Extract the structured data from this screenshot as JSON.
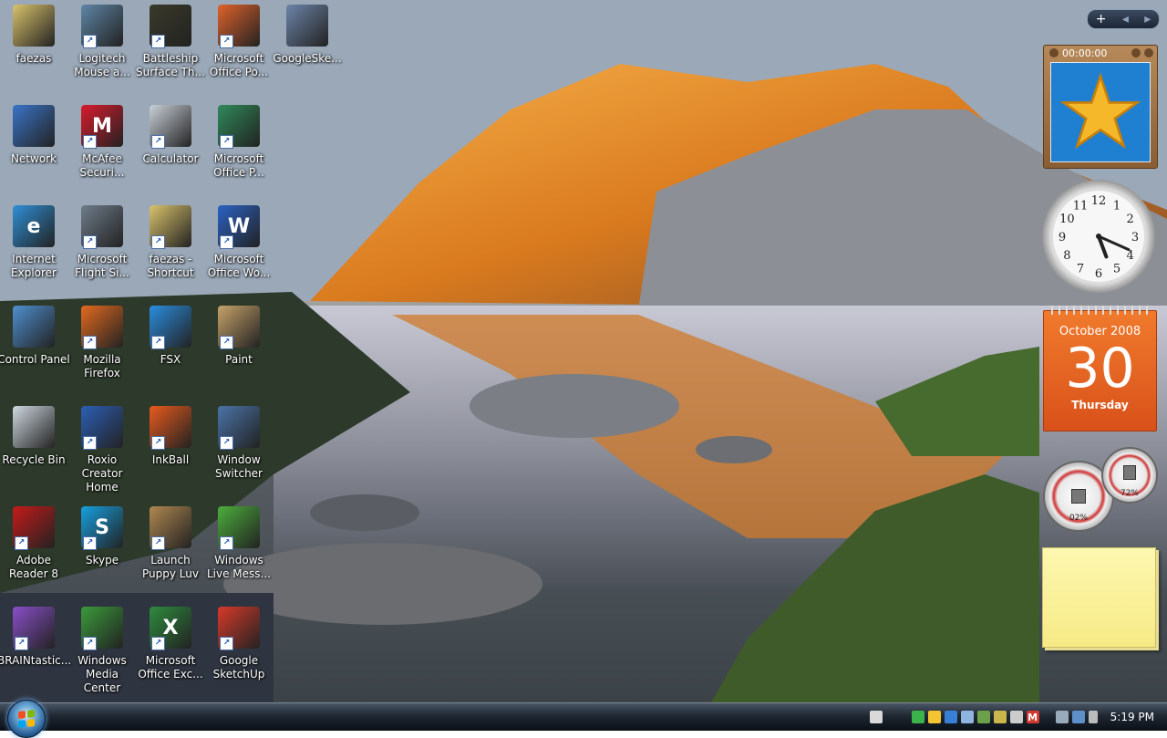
{
  "desktop": {
    "icons": [
      {
        "label": "faezas",
        "icon": "folder-icon",
        "color": "#d9c36b",
        "glyph": "",
        "shortcut": false
      },
      {
        "label": "Logitech Mouse a...",
        "icon": "mouse-icon",
        "color": "#5f86a6",
        "glyph": "",
        "shortcut": true
      },
      {
        "label": "Battleship Surface Th...",
        "icon": "game-icon",
        "color": "#3a3a2a",
        "glyph": "",
        "shortcut": true
      },
      {
        "label": "Microsoft Office Po...",
        "icon": "powerpoint-icon",
        "color": "#e0622b",
        "glyph": "",
        "shortcut": true
      },
      {
        "label": "GoogleSke...",
        "icon": "installer-icon",
        "color": "#6d84a8",
        "glyph": "",
        "shortcut": false
      },
      {
        "label": "Network",
        "icon": "network-icon",
        "color": "#3a74c7",
        "glyph": "",
        "shortcut": false
      },
      {
        "label": "McAfee Securi...",
        "icon": "mcafee-icon",
        "color": "#d91b2c",
        "glyph": "M",
        "shortcut": true
      },
      {
        "label": "Calculator",
        "icon": "calculator-icon",
        "color": "#c9d0d8",
        "glyph": "",
        "shortcut": true
      },
      {
        "label": "Microsoft Office P...",
        "icon": "publisher-icon",
        "color": "#2f8a5a",
        "glyph": "",
        "shortcut": true
      },
      {
        "label": "Internet Explorer",
        "icon": "internet-explorer-icon",
        "color": "#2f8fd6",
        "glyph": "e",
        "shortcut": false
      },
      {
        "label": "Microsoft Flight Si...",
        "icon": "airplane-icon",
        "color": "#6f7c8a",
        "glyph": "",
        "shortcut": true
      },
      {
        "label": "faezas - Shortcut",
        "icon": "folder-icon",
        "color": "#d9c36b",
        "glyph": "",
        "shortcut": true
      },
      {
        "label": "Microsoft Office Wo...",
        "icon": "word-icon",
        "color": "#2b62c4",
        "glyph": "W",
        "shortcut": true
      },
      {
        "label": "Control Panel",
        "icon": "control-panel-icon",
        "color": "#4f8fcf",
        "glyph": "",
        "shortcut": false
      },
      {
        "label": "Mozilla Firefox",
        "icon": "firefox-icon",
        "color": "#e46a1f",
        "glyph": "",
        "shortcut": true
      },
      {
        "label": "FSX",
        "icon": "fsx-icon",
        "color": "#2a8de0",
        "glyph": "",
        "shortcut": true
      },
      {
        "label": "Paint",
        "icon": "paint-icon",
        "color": "#c7a26a",
        "glyph": "",
        "shortcut": true
      },
      {
        "label": "Recycle Bin",
        "icon": "recycle-bin-icon",
        "color": "#cfd8e0",
        "glyph": "",
        "shortcut": false
      },
      {
        "label": "Roxio Creator Home",
        "icon": "disc-icon",
        "color": "#2c5fb6",
        "glyph": "",
        "shortcut": true
      },
      {
        "label": "InkBall",
        "icon": "inkball-icon",
        "color": "#e95a1d",
        "glyph": "",
        "shortcut": true
      },
      {
        "label": "Window Switcher",
        "icon": "window-switcher-icon",
        "color": "#4a74a8",
        "glyph": "",
        "shortcut": true
      },
      {
        "label": "Adobe Reader 8",
        "icon": "adobe-reader-icon",
        "color": "#c61a1a",
        "glyph": "",
        "shortcut": true
      },
      {
        "label": "Skype",
        "icon": "skype-icon",
        "color": "#16a0e0",
        "glyph": "S",
        "shortcut": true
      },
      {
        "label": "Launch Puppy Luv",
        "icon": "puppy-icon",
        "color": "#b08850",
        "glyph": "",
        "shortcut": true
      },
      {
        "label": "Windows Live Mess...",
        "icon": "messenger-icon",
        "color": "#4cae3c",
        "glyph": "",
        "shortcut": true
      },
      {
        "label": "BRAINtastic...",
        "icon": "braintastic-icon",
        "color": "#8a4fc9",
        "glyph": "",
        "shortcut": true
      },
      {
        "label": "Windows Media Center",
        "icon": "media-center-icon",
        "color": "#3b9b3b",
        "glyph": "",
        "shortcut": true
      },
      {
        "label": "Microsoft Office Exc...",
        "icon": "excel-icon",
        "color": "#2e8b3e",
        "glyph": "X",
        "shortcut": true
      },
      {
        "label": "Google SketchUp",
        "icon": "sketchup-icon",
        "color": "#d83a2a",
        "glyph": "",
        "shortcut": true
      }
    ]
  },
  "sidebar": {
    "controls": [
      "+",
      "◂",
      "▸"
    ],
    "slideshow": {
      "time": "00:00:00",
      "icon": "star-icon"
    },
    "clock": {
      "numbers": [
        "12",
        "1",
        "2",
        "3",
        "4",
        "5",
        "6",
        "7",
        "8",
        "9",
        "10",
        "11"
      ],
      "hour": 5,
      "minute": 19
    },
    "calendar": {
      "month_year": "October 2008",
      "day": "30",
      "weekday": "Thursday"
    },
    "cpu_meter": {
      "cpu": "02%",
      "memory": "72%"
    },
    "notes": {
      "text": ""
    }
  },
  "taskbar": {
    "clock": "5:19 PM",
    "tray_icons": [
      "pen-icon",
      "shield-check-icon",
      "network-icon",
      "firewall-icon",
      "display-icon",
      "volume-icon",
      "mcafee-icon"
    ],
    "colors": {
      "green": "#3cb34a",
      "blue": "#3a7fd6",
      "red": "#d33a2f",
      "yellow": "#f5c431"
    }
  }
}
